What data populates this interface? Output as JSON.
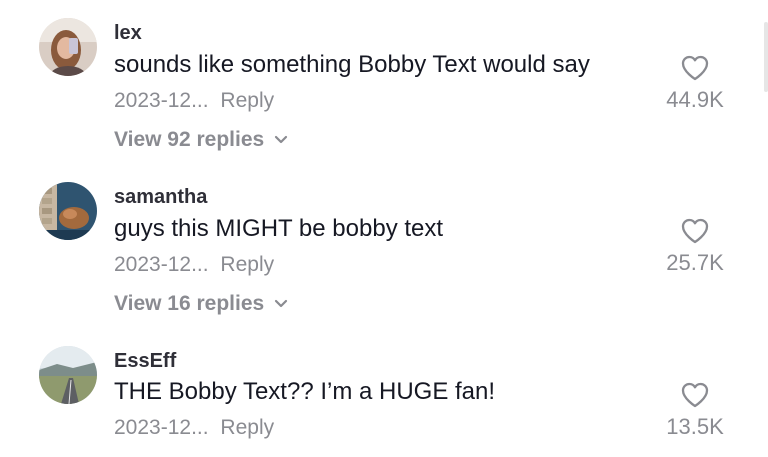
{
  "comments": [
    {
      "username": "lex",
      "text": "sounds like something Bobby Text would say",
      "date": "2023-12...",
      "reply_label": "Reply",
      "likes": "44.9K",
      "view_replies": "View 92 replies"
    },
    {
      "username": "samantha",
      "text": "guys this MIGHT be bobby text",
      "date": "2023-12...",
      "reply_label": "Reply",
      "likes": "25.7K",
      "view_replies": "View 16 replies"
    },
    {
      "username": "EssEff",
      "text": "THE Bobby Text?? I’m a HUGE fan!",
      "date": "2023-12...",
      "reply_label": "Reply",
      "likes": "13.5K"
    }
  ],
  "icons": {
    "like": "heart-outline-icon",
    "expand": "chevron-down-icon"
  },
  "colors": {
    "primary_text": "#161823",
    "secondary_text": "#8a8b91",
    "background": "#ffffff"
  }
}
